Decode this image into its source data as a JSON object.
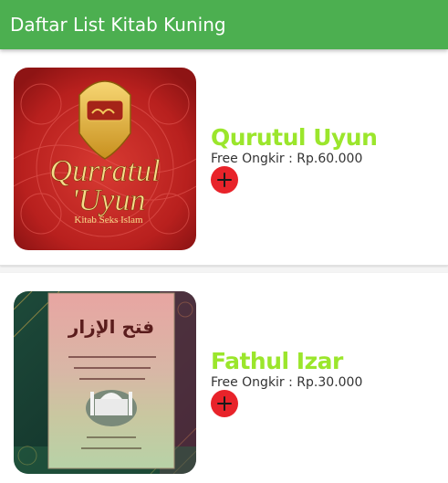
{
  "appbar": {
    "title": "Daftar List Kitab Kuning"
  },
  "colors": {
    "appbar": "#4caf50",
    "title_text": "#9be62c",
    "add_button": "#e8232a"
  },
  "books": [
    {
      "title": "Qurutul Uyun",
      "price": "Free Ongkir : Rp.60.000",
      "cover_title_line1": "Qurratul",
      "cover_title_line2": "'Uyun",
      "cover_subtitle": "Kitab Seks Islam",
      "add_icon": "plus-icon"
    },
    {
      "title": "Fathul Izar",
      "price": "Free Ongkir : Rp.30.000",
      "cover_title": "فتح الإزار",
      "add_icon": "plus-icon"
    }
  ]
}
